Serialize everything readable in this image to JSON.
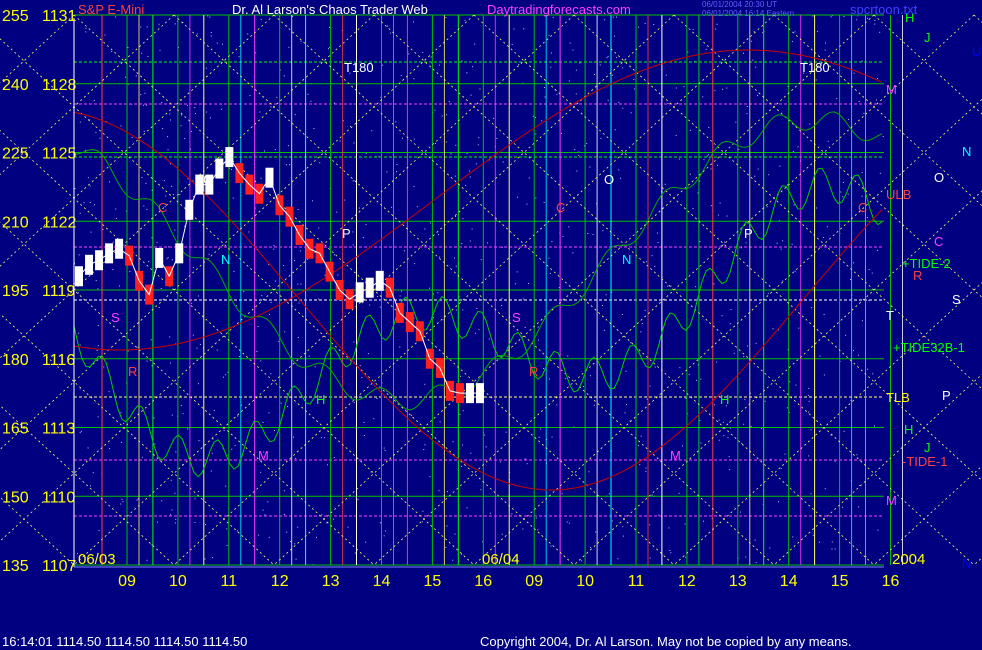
{
  "header": {
    "symbol": "S&P E-Mini",
    "title": "Dr. Al Larson's Chaos Trader Web",
    "site": "Daytradingforecasts.com",
    "stamp_line1": "06/01/2004 20:30 UT",
    "stamp_line2": "06/01/2004 16:14 Eastern",
    "credit": "spcrtoon.txt"
  },
  "footer": {
    "quote": "16:14:01  1114.50 1114.50 1114.50 1114.50",
    "copyright": "Copyright 2004, Dr. Al Larson. May not be copied by any means."
  },
  "colors": {
    "background": "#000080",
    "price_up": "#ffffff",
    "price_down": "#ff2020",
    "green_tide": "#00cc00",
    "red_tide": "#cc0000",
    "yellow": "#ffff00"
  },
  "chart_data": {
    "type": "line",
    "y_left_inner": [
      "255",
      "240",
      "225",
      "210",
      "195",
      "180",
      "165",
      "150",
      "135"
    ],
    "y_left_price": [
      "1131",
      "1128",
      "1125",
      "1122",
      "1119",
      "1116",
      "1113",
      "1110",
      "1107"
    ],
    "ylim": [
      1107,
      1131
    ],
    "x_tick_labels": [
      "09",
      "10",
      "11",
      "12",
      "13",
      "14",
      "15",
      "16",
      "09",
      "10",
      "11",
      "12",
      "13",
      "14",
      "15",
      "16"
    ],
    "date_labels": [
      "06/03",
      "06/04"
    ],
    "year_label": "2004",
    "right_labels": [
      "H",
      "J",
      "U",
      "M",
      "N",
      "O",
      "ULB",
      "C",
      "+TIDE-2",
      "R",
      "S",
      "T",
      "+TIDE32B-1",
      "TLB",
      "P",
      "H",
      "J",
      "-TIDE-1",
      "M",
      "N"
    ],
    "chart_letters": [
      "O",
      "C",
      "N",
      "P",
      "S",
      "R",
      "H",
      "M",
      "O",
      "C",
      "N",
      "P",
      "S",
      "R",
      "H",
      "M",
      "T180",
      "T180",
      "C"
    ],
    "price_series": {
      "name": "S&P E-Mini",
      "x": [
        0,
        0.2,
        0.4,
        0.6,
        0.8,
        1,
        1.2,
        1.4,
        1.6,
        1.8,
        2,
        2.2,
        2.4,
        2.6,
        2.8,
        3,
        3.2,
        3.4,
        3.6,
        3.8,
        4,
        4.2,
        4.4,
        4.6,
        4.8,
        5,
        5.2,
        5.4,
        5.6,
        5.8,
        6,
        6.2,
        6.4,
        6.6,
        6.8,
        7,
        7.2,
        7.4,
        7.6,
        7.8,
        8
      ],
      "y": [
        1119.6,
        1120.1,
        1120.3,
        1120.6,
        1120.8,
        1120.5,
        1119.4,
        1118.8,
        1120.4,
        1119.6,
        1120.6,
        1122.5,
        1123.6,
        1123.6,
        1124.3,
        1124.8,
        1124.1,
        1123.6,
        1123.2,
        1123.9,
        1122.7,
        1122.2,
        1121.4,
        1120.8,
        1120.6,
        1119.8,
        1119.0,
        1118.6,
        1118.9,
        1119.1,
        1119.4,
        1119.1,
        1118.0,
        1117.6,
        1117.2,
        1116.0,
        1115.6,
        1114.6,
        1114.5,
        1114.5,
        1114.5
      ]
    },
    "flux_lines": [
      {
        "name": "+TIDE-2",
        "color": "#00cc00"
      },
      {
        "name": "+TIDE32B-1",
        "color": "#00cc00"
      },
      {
        "name": "-TIDE-1",
        "color": "#cc0000"
      },
      {
        "name": "ULB",
        "color": "#cc0000"
      },
      {
        "name": "TLB",
        "color": "#ffff00"
      }
    ]
  }
}
